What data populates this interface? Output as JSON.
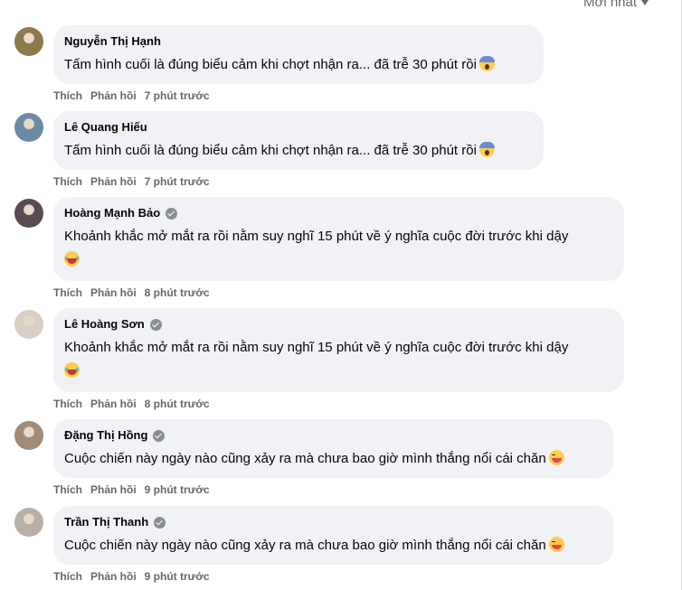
{
  "sort": {
    "label": "Mới nhất"
  },
  "actions": {
    "like": "Thích",
    "reply": "Phản hồi"
  },
  "comments": [
    {
      "author": "Nguyễn Thị Hạnh",
      "verified": false,
      "text": "Tấm hình cuối là đúng biểu cảm khi chợt nhận ra... đã trễ 30 phút rồi",
      "emoji": "face-screaming-icon",
      "time": "7 phút trước",
      "avatar_color": "#8c7a4a"
    },
    {
      "author": "Lê Quang Hiếu",
      "verified": false,
      "text": "Tấm hình cuối là đúng biểu cảm khi chợt nhận ra... đã trễ 30 phút rồi",
      "emoji": "face-screaming-icon",
      "time": "7 phút trước",
      "avatar_color": "#6b8aa6"
    },
    {
      "author": "Hoàng Mạnh Bảo",
      "verified": true,
      "text": "Khoảnh khắc mở mắt ra rồi nằm suy nghĩ 15 phút về ý nghĩa cuộc đời trước khi dậy",
      "emoji": "face-with-tears-of-joy-icon",
      "time": "8 phút trước",
      "avatar_color": "#5a4a52"
    },
    {
      "author": "Lê Hoàng Sơn",
      "verified": true,
      "text": "Khoảnh khắc mở mắt ra rồi nằm suy nghĩ 15 phút về ý nghĩa cuộc đời trước khi dậy",
      "emoji": "face-with-tears-of-joy-icon",
      "time": "8 phút trước",
      "avatar_color": "#d8cfc6"
    },
    {
      "author": "Đặng Thị Hồng",
      "verified": true,
      "text": "Cuộc chiến này ngày nào cũng xảy ra mà chưa bao giờ mình thắng nổi cái chăn",
      "emoji": "grinning-squinting-face-icon",
      "time": "9 phút trước",
      "avatar_color": "#a08a78"
    },
    {
      "author": "Trần Thị Thanh",
      "verified": true,
      "text": "Cuộc chiến này ngày nào cũng xảy ra mà chưa bao giờ mình thắng nổi cái chăn",
      "emoji": "grinning-squinting-face-icon",
      "time": "9 phút trước",
      "avatar_color": "#b8b0a8"
    }
  ]
}
